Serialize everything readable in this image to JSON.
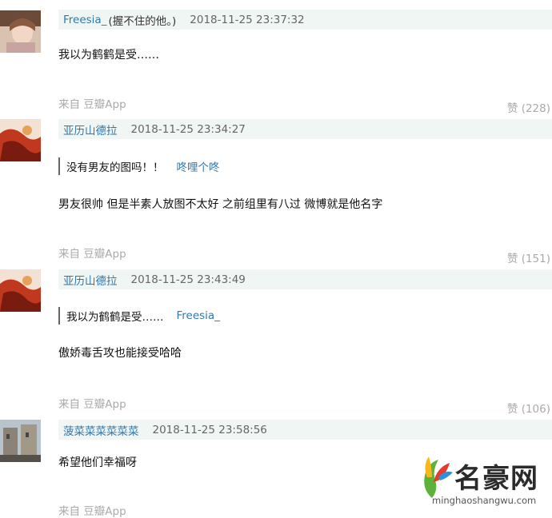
{
  "comments": [
    {
      "user": "Freesia_",
      "signature": "(握不住的他。)",
      "time": "2018-11-25 23:37:32",
      "text": "我以为鹤鹤是受……",
      "source": "来自 豆瓣App",
      "likes": "赞 (228)"
    },
    {
      "user": "亚历山德拉",
      "time": "2018-11-25 23:34:27",
      "quote": {
        "text": "没有男友的图吗！！",
        "author": "咚哩个咚"
      },
      "text": "男友很帅 但是半素人放图不太好 之前组里有八过 微博就是他名字",
      "source": "来自 豆瓣App",
      "likes": "赞 (151)"
    },
    {
      "user": "亚历山德拉",
      "time": "2018-11-25 23:43:49",
      "quote": {
        "text": "我以为鹤鹤是受……",
        "author": "Freesia_"
      },
      "text": "傲娇毒舌攻也能接受哈哈",
      "source": "来自 豆瓣App",
      "likes": "赞 (106)"
    },
    {
      "user": "菠菜菜菜菜菜菜",
      "time": "2018-11-25 23:58:56",
      "text": "希望他们幸福呀",
      "source": "来自 豆瓣App"
    }
  ],
  "watermark": {
    "name": "名豪网",
    "url": "minghaoshangwu.com"
  }
}
